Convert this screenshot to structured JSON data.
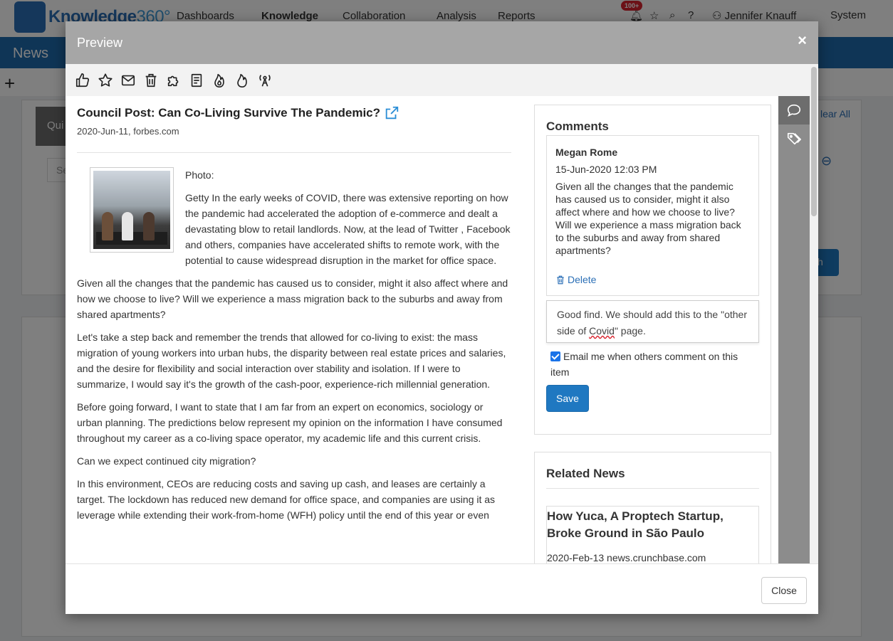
{
  "app": {
    "logo_text": "Knowledge",
    "logo_num": "360°",
    "nav": [
      "Dashboards",
      "Knowledge",
      "Collaboration",
      "Analysis",
      "Reports"
    ],
    "notification_badge": "100+",
    "user": "Jennifer Knauff",
    "system": "System",
    "page_title": "News",
    "bg_clear_all": "lear All",
    "bg_search_button": "h",
    "bg_search_tab": "Qui",
    "bg_search_placeholder": "Se"
  },
  "modal": {
    "title": "Preview",
    "close_symbol": "×",
    "toolbar_icons": [
      "like-icon",
      "star-icon",
      "mail-icon",
      "trash-icon",
      "puzzle-icon",
      "document-icon",
      "fire-icon",
      "fire-outline-icon",
      "broadcast-icon"
    ],
    "article": {
      "title": "Council Post: Can Co-Living Survive The Pandemic?",
      "meta": "2020-Jun-11, forbes.com",
      "photo_caption": "Photo:",
      "paragraphs": [
        "Getty In the early weeks of COVID, there was extensive reporting on how the pandemic had accelerated the adoption of e-commerce and dealt a devastating blow to retail landlords. Now, at the lead of Twitter , Facebook and others, companies have accelerated shifts to remote work, with the potential to cause widespread disruption in the market for office space.",
        "Given all the changes that the pandemic has caused us to consider, might it also affect where and how we choose to live? Will we experience a mass migration back to the suburbs and away from shared apartments?",
        "Let's take a step back and remember the trends that allowed for co-living to exist: the mass migration of young workers into urban hubs, the disparity between real estate prices and salaries, and the desire for flexibility and social interaction over stability and isolation. If I were to summarize, I would say it's the growth of the cash-poor, experience-rich millennial generation.",
        "Before going forward, I want to state that I am far from an expert on economics, sociology or urban planning. The predictions below represent my opinion on the information I have consumed throughout my career as a co-living space operator, my academic life and this current crisis.",
        "Can we expect continued city migration?",
        "In this environment, CEOs are reducing costs and saving up cash, and leases are certainly a target. The lockdown has reduced new demand for office space, and companies are using it as leverage while extending their work-from-home (WFH) policy until the end of this year or even"
      ]
    },
    "comments": {
      "heading": "Comments",
      "items": [
        {
          "author": "Megan Rome",
          "date": "15-Jun-2020 12:03 PM",
          "text": "Given all the changes that the pandemic has caused us to consider, might it also affect where and how we choose to live? Will we experience a mass migration back to the suburbs and away from shared apartments?",
          "delete_label": "Delete"
        }
      ],
      "input_value_before": "Good find. We should add this to the \"other side of ",
      "input_value_squiggle": "Covid",
      "input_value_after": "\" page.",
      "email_label": "Email me when others comment on this item",
      "email_checked": true,
      "save_label": "Save"
    },
    "related": {
      "heading": "Related News",
      "items": [
        {
          "title": "How Yuca, A Proptech Startup, Broke Ground in São Paulo",
          "meta": "2020-Feb-13 news.crunchbase.com"
        }
      ]
    },
    "close_label": "Close"
  },
  "colors": {
    "brand_blue": "#1f6aad",
    "header_gray": "#a6a6a6",
    "link_blue": "#2b6fb6",
    "badge_red": "#d9232e"
  }
}
